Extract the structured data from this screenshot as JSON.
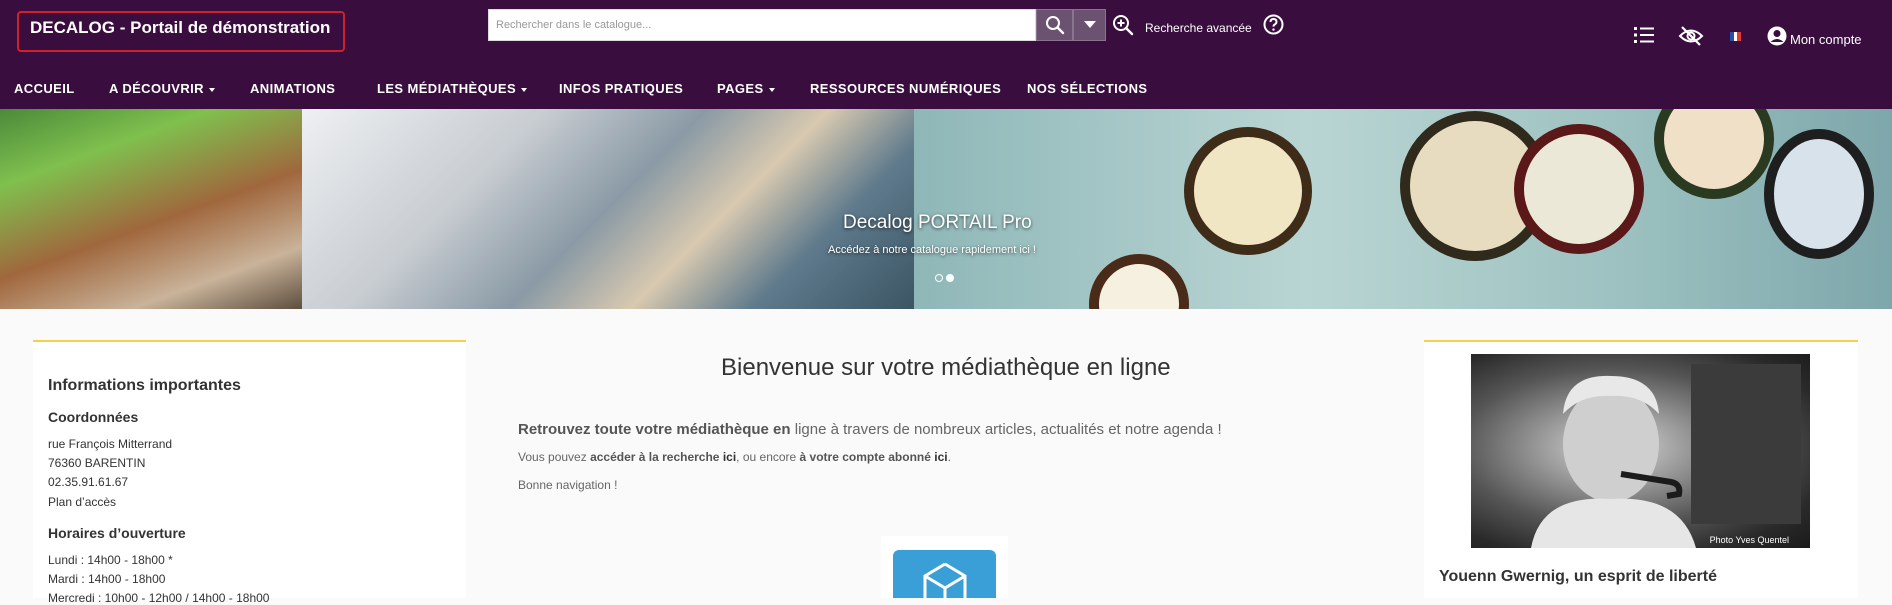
{
  "header": {
    "brand": "DECALOG - Portail de démonstration",
    "search_placeholder": "Rechercher dans le catalogue...",
    "advanced_search": "Recherche avancée",
    "account": "Mon compte",
    "colors": {
      "background": "#3a0d3f",
      "search_button": "#6c5271",
      "brand_border": "#d0202a"
    }
  },
  "nav": {
    "items": [
      {
        "label": "ACCUEIL",
        "dropdown": false
      },
      {
        "label": "A DÉCOUVRIR",
        "dropdown": true
      },
      {
        "label": "ANIMATIONS",
        "dropdown": false
      },
      {
        "label": "LES MÉDIATHÈQUES",
        "dropdown": true
      },
      {
        "label": "INFOS PRATIQUES",
        "dropdown": false
      },
      {
        "label": "PAGES",
        "dropdown": true
      },
      {
        "label": "RESSOURCES NUMÉRIQUES",
        "dropdown": false
      },
      {
        "label": "NOS SÉLECTIONS",
        "dropdown": false
      }
    ]
  },
  "banner": {
    "title": "Decalog PORTAIL Pro",
    "subtitle": "Accédez à notre catalogue rapidement ici !"
  },
  "info": {
    "title": "Informations importantes",
    "contact_heading": "Coordonnées",
    "address_line1": "rue François Mitterrand",
    "address_line2": "76360 BARENTIN",
    "phone": "02.35.91.61.67",
    "map_link": "Plan d’accès",
    "hours_heading": "Horaires d’ouverture",
    "hours": [
      "Lundi : 14h00 - 18h00 *",
      "Mardi : 14h00 - 18h00",
      "Mercredi : 10h00 - 12h00 / 14h00 - 18h00"
    ]
  },
  "welcome": {
    "title": "Bienvenue sur votre médiathèque en ligne",
    "intro_bold": "Retrouvez toute votre médiathèque en",
    "intro_rest": " ligne à travers de nombreux articles, actualités et notre agenda !",
    "line2_a": "Vous pouvez ",
    "line2_b": "accéder à la recherche",
    "line2_c": "ici",
    "line2_d": ", ou encore ",
    "line2_e": "à votre compte abonné",
    "line2_f": "ici",
    "line2_g": ".",
    "line3": "Bonne navigation !"
  },
  "feature": {
    "photo_credit": "Photo Yves Quentel",
    "title": "Youenn Gwernig, un esprit de liberté"
  },
  "icons": [
    "search-icon",
    "chevron-down-icon",
    "zoom-in-icon",
    "help-icon",
    "list-icon",
    "eye-off-icon",
    "flag-fr-icon",
    "user-icon"
  ]
}
